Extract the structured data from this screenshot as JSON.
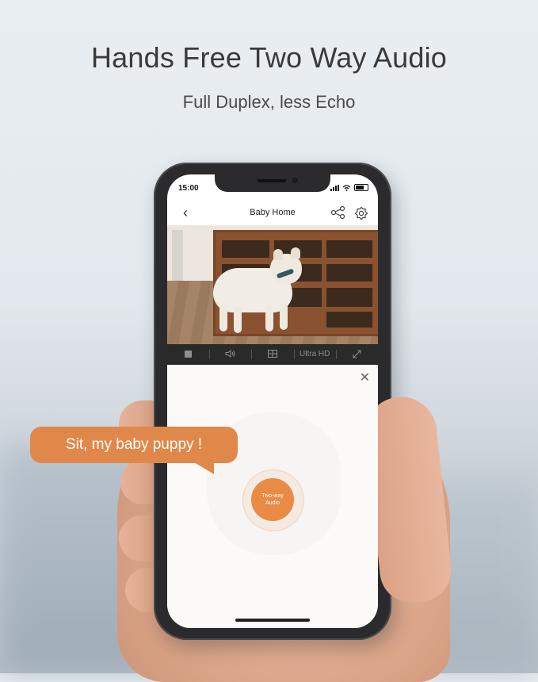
{
  "headline": "Hands Free Two Way Audio",
  "subheadline": "Full Duplex, less Echo",
  "speech_bubble": "Sit, my baby puppy !",
  "phone": {
    "status_bar": {
      "time": "15:00"
    },
    "nav": {
      "back_icon": "chevron-left-icon",
      "title": "Baby Home",
      "share_icon": "share-icon",
      "settings_icon": "gear-icon"
    },
    "video": {
      "description_icon": "camera-feed"
    },
    "controls": {
      "items": [
        {
          "icon": "stop-icon"
        },
        {
          "icon": "speaker-icon"
        },
        {
          "icon": "grid-icon"
        },
        {
          "label": "Ultra HD"
        },
        {
          "icon": "fullscreen-icon"
        }
      ]
    },
    "audio_panel": {
      "close_icon": "close-icon",
      "button_line1": "Two-way",
      "button_line2": "Audio"
    }
  },
  "colors": {
    "accent": "#e98b44",
    "bubble": "#e0884a"
  }
}
